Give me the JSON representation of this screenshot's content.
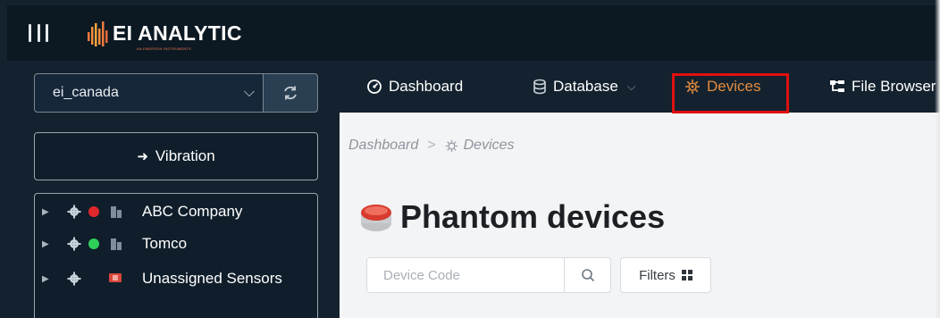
{
  "app": {
    "logo_text": "EI ANALYTIC",
    "logo_subtext": "AN EMERSON INSTRUMENTS"
  },
  "sidebar": {
    "site_select": {
      "value": "ei_canada"
    },
    "vibration_button": "Vibration",
    "tree": [
      {
        "label": "ABC Company",
        "status_color": "#e0282d"
      },
      {
        "label": "Tomco",
        "status_color": "#2fcf5a"
      },
      {
        "label": "Unassigned Sensors",
        "status_color": ""
      }
    ]
  },
  "nav": {
    "items": [
      {
        "label": "Dashboard",
        "icon": "dashboard-icon"
      },
      {
        "label": "Database",
        "icon": "database-icon",
        "has_dropdown": true
      },
      {
        "label": "Devices",
        "icon": "devices-icon",
        "active": true
      },
      {
        "label": "File Browser",
        "icon": "file-browser-icon"
      }
    ]
  },
  "breadcrumb": {
    "items": [
      "Dashboard",
      "Devices"
    ]
  },
  "main": {
    "title": "Phantom devices",
    "search_placeholder": "Device Code",
    "filters_label": "Filters"
  },
  "colors": {
    "accent": "#e58b3f",
    "highlight_box": "#e01010",
    "topbar": "#0c1923",
    "sidebar": "#13222e"
  }
}
